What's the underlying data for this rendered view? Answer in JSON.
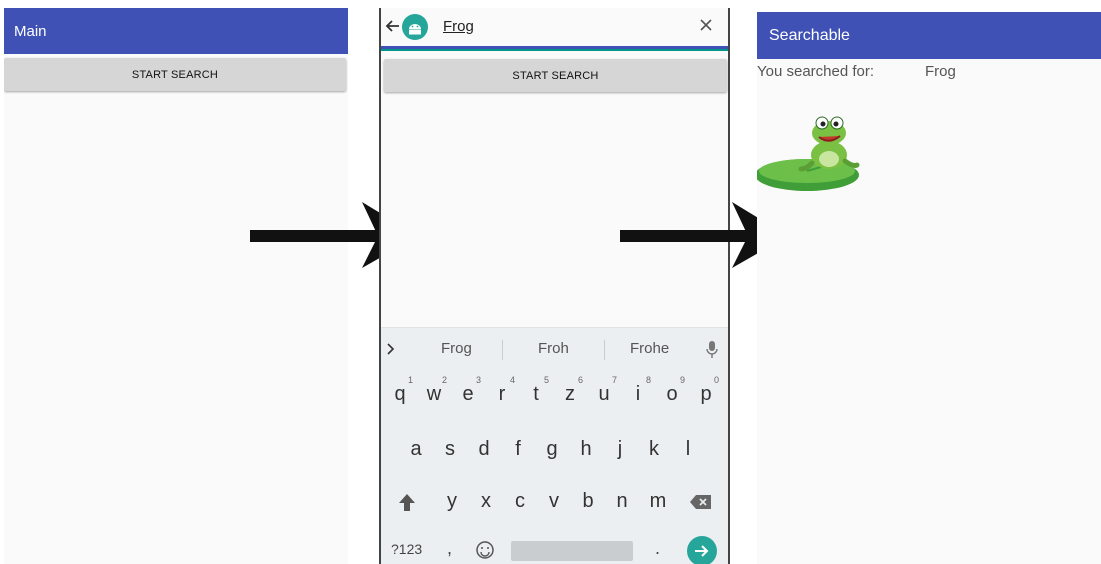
{
  "screen1": {
    "title": "Main",
    "button_label": "START SEARCH"
  },
  "screen2": {
    "query": "Frog",
    "button_label": "START SEARCH",
    "suggestions": [
      "Frog",
      "Froh",
      "Frohe"
    ],
    "rows": {
      "row1": [
        "q",
        "w",
        "e",
        "r",
        "t",
        "z",
        "u",
        "i",
        "o",
        "p"
      ],
      "row1_digits": [
        "1",
        "2",
        "3",
        "4",
        "5",
        "6",
        "7",
        "8",
        "9",
        "0"
      ],
      "row2": [
        "a",
        "s",
        "d",
        "f",
        "g",
        "h",
        "j",
        "k",
        "l"
      ],
      "row3": [
        "y",
        "x",
        "c",
        "v",
        "b",
        "n",
        "m"
      ],
      "symbols_key": "?123",
      "comma": ",",
      "period": "."
    }
  },
  "screen3": {
    "title": "Searchable",
    "searched_label": "You searched for:",
    "searched_value": "Frog"
  },
  "icons": {
    "back": "back-arrow-icon",
    "app": "android-app-icon",
    "close": "close-icon",
    "mic": "microphone-icon",
    "shift": "shift-icon",
    "backspace": "backspace-icon",
    "emoji": "emoji-icon",
    "enter": "enter-arrow-icon",
    "frog": "frog-on-lilypad-image"
  },
  "colors": {
    "appbar": "#3f51b5",
    "accent": "#26a69a"
  }
}
